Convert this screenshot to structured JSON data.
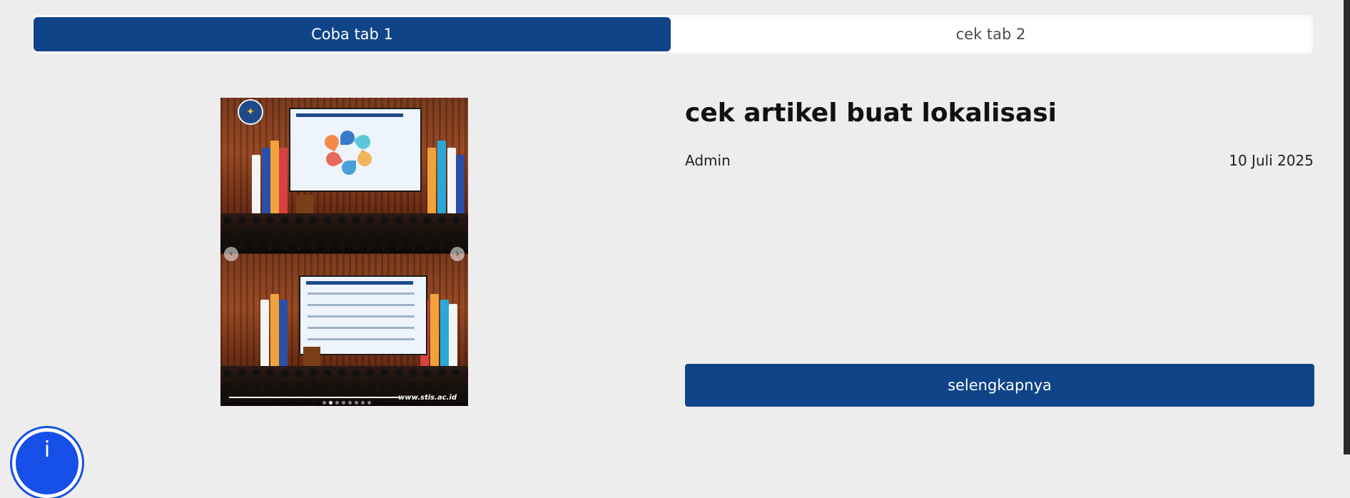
{
  "tabs": [
    {
      "label": "Coba tab 1",
      "active": true
    },
    {
      "label": "cek tab 2",
      "active": false
    }
  ],
  "article": {
    "title": "cek artikel buat lokalisasi",
    "author": "Admin",
    "date": "10 Juli 2025",
    "read_more_label": "selengkapnya"
  },
  "carousel": {
    "prev_icon": "chevron-left-icon",
    "next_icon": "chevron-right-icon",
    "watermark": "www.stis.ac.id",
    "dot_count": 8,
    "active_dot": 1
  },
  "accessibility_button": {
    "icon": "info-icon",
    "glyph": "i"
  },
  "colors": {
    "primary": "#0f4488",
    "background": "#ededed",
    "tab_inactive": "#ffffff",
    "fab": "#1650e8"
  }
}
